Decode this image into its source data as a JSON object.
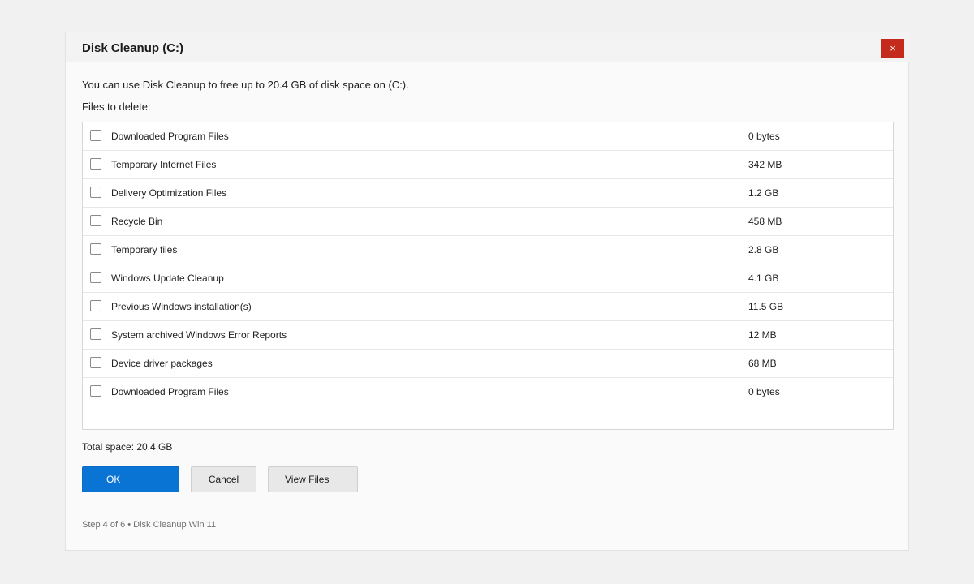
{
  "dialog": {
    "title": "Disk Cleanup (C:)",
    "close_label": "×",
    "intro": "You can use Disk Cleanup to free up to 20.4 GB of disk space on (C:).",
    "files_label": "Files to delete:",
    "files": [
      {
        "name": "Downloaded Program Files",
        "size": "0 bytes",
        "checked": false
      },
      {
        "name": "Temporary Internet Files",
        "size": "342 MB",
        "checked": false
      },
      {
        "name": "Delivery Optimization Files",
        "size": "1.2 GB",
        "checked": false
      },
      {
        "name": "Recycle Bin",
        "size": "458 MB",
        "checked": false
      },
      {
        "name": "Temporary files",
        "size": "2.8 GB",
        "checked": false
      },
      {
        "name": "Windows Update Cleanup",
        "size": "4.1 GB",
        "checked": false
      },
      {
        "name": "Previous Windows installation(s)",
        "size": "11.5 GB",
        "checked": false
      },
      {
        "name": "System archived Windows Error Reports",
        "size": "12 MB",
        "checked": false
      },
      {
        "name": "Device driver packages",
        "size": "68 MB",
        "checked": false
      },
      {
        "name": "Downloaded Program Files",
        "size": "0 bytes",
        "checked": false
      }
    ],
    "total": "Total space: 20.4 GB",
    "buttons": {
      "ok": "OK",
      "cancel": "Cancel",
      "view_files": "View Files"
    },
    "footer": "Step 4 of 6 • Disk Cleanup Win 11"
  },
  "colors": {
    "accent": "#0a74d4",
    "close": "#c42b1c",
    "background": "#f1f1f1"
  },
  "icons": {
    "close": "close-icon",
    "checkbox": "checkbox-unchecked-icon"
  }
}
